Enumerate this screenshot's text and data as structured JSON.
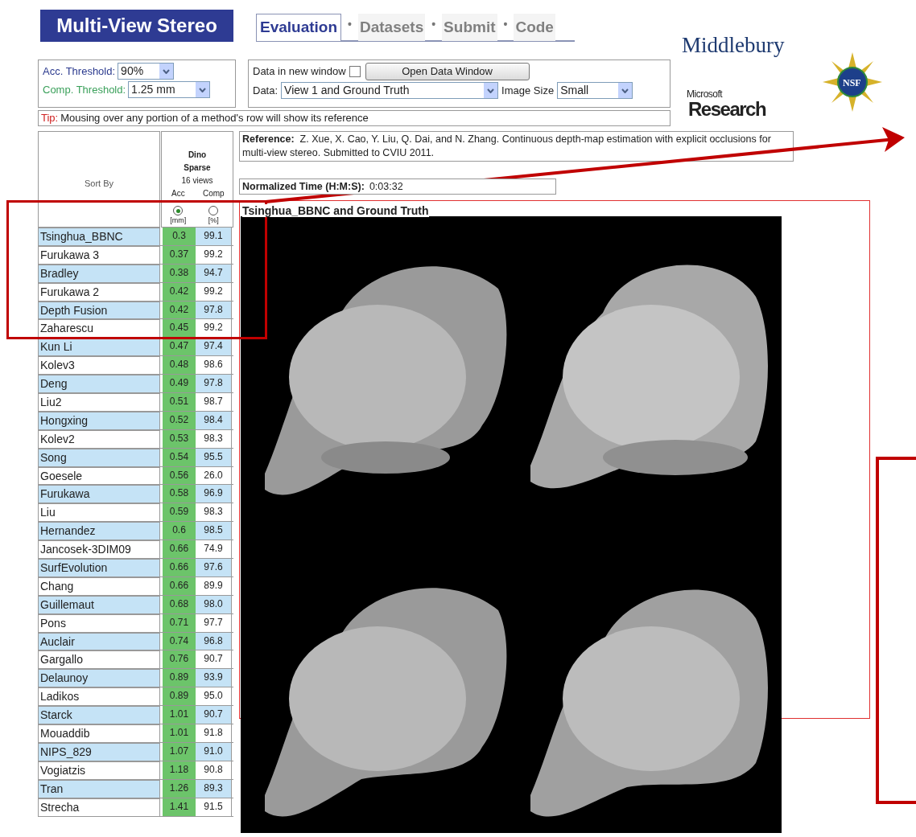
{
  "header": {
    "title": "Multi-View Stereo",
    "tabs": [
      {
        "kind": "tab",
        "label": "Evaluation",
        "selected": true
      },
      {
        "kind": "separator",
        "label": "•"
      },
      {
        "kind": "tab",
        "label": "Datasets",
        "selected": false
      },
      {
        "kind": "separator",
        "label": "•"
      },
      {
        "kind": "tab",
        "label": "Submit",
        "selected": false
      },
      {
        "kind": "separator",
        "label": "•"
      },
      {
        "kind": "tab",
        "label": "Code",
        "selected": false
      }
    ]
  },
  "logos": {
    "middlebury": "Middlebury",
    "microsoft": "Microsoft",
    "research": "Research",
    "nsf": "NSF"
  },
  "controls": {
    "acc_threshold": {
      "label": "Acc. Threshold:",
      "value": "90%"
    },
    "comp_threshold": {
      "label": "Comp. Threshold:",
      "value": "1.25 mm"
    },
    "new_window": {
      "label": "Data in new window",
      "checked": false
    },
    "open_button": "Open Data Window",
    "data": {
      "label": "Data:",
      "value": "View 1 and Ground Truth"
    },
    "image_size": {
      "label": "Image Size",
      "value": "Small"
    }
  },
  "tip": {
    "label": "Tip:",
    "text": "Mousing over any portion of a method's row will show its reference"
  },
  "table": {
    "dataset": "Dino",
    "subset": "Sparse",
    "views": "16 views",
    "sort_by": "Sort By",
    "columns": [
      {
        "label": "Acc",
        "unit": "[mm]",
        "selected": true
      },
      {
        "label": "Comp",
        "unit": "[%]",
        "selected": false
      }
    ],
    "rows": [
      {
        "method": "Tsinghua_BBNC",
        "acc": "0.3",
        "comp": "99.1"
      },
      {
        "method": "Furukawa 3",
        "acc": "0.37",
        "comp": "99.2"
      },
      {
        "method": "Bradley",
        "acc": "0.38",
        "comp": "94.7"
      },
      {
        "method": "Furukawa 2",
        "acc": "0.42",
        "comp": "99.2"
      },
      {
        "method": "Depth Fusion",
        "acc": "0.42",
        "comp": "97.8"
      },
      {
        "method": "Zaharescu",
        "acc": "0.45",
        "comp": "99.2"
      },
      {
        "method": "Kun Li",
        "acc": "0.47",
        "comp": "97.4"
      },
      {
        "method": "Kolev3",
        "acc": "0.48",
        "comp": "98.6"
      },
      {
        "method": "Deng",
        "acc": "0.49",
        "comp": "97.8"
      },
      {
        "method": "Liu2",
        "acc": "0.51",
        "comp": "98.7"
      },
      {
        "method": "Hongxing",
        "acc": "0.52",
        "comp": "98.4"
      },
      {
        "method": "Kolev2",
        "acc": "0.53",
        "comp": "98.3"
      },
      {
        "method": "Song",
        "acc": "0.54",
        "comp": "95.5"
      },
      {
        "method": "Goesele",
        "acc": "0.56",
        "comp": "26.0"
      },
      {
        "method": "Furukawa",
        "acc": "0.58",
        "comp": "96.9"
      },
      {
        "method": "Liu",
        "acc": "0.59",
        "comp": "98.3"
      },
      {
        "method": "Hernandez",
        "acc": "0.6",
        "comp": "98.5"
      },
      {
        "method": "Jancosek-3DIM09",
        "acc": "0.66",
        "comp": "74.9"
      },
      {
        "method": "SurfEvolution",
        "acc": "0.66",
        "comp": "97.6"
      },
      {
        "method": "Chang",
        "acc": "0.66",
        "comp": "89.9"
      },
      {
        "method": "Guillemaut",
        "acc": "0.68",
        "comp": "98.0"
      },
      {
        "method": "Pons",
        "acc": "0.71",
        "comp": "97.7"
      },
      {
        "method": "Auclair",
        "acc": "0.74",
        "comp": "96.8"
      },
      {
        "method": "Gargallo",
        "acc": "0.76",
        "comp": "90.7"
      },
      {
        "method": "Delaunoy",
        "acc": "0.89",
        "comp": "93.9"
      },
      {
        "method": "Ladikos",
        "acc": "0.89",
        "comp": "95.0"
      },
      {
        "method": "Starck",
        "acc": "1.01",
        "comp": "90.7"
      },
      {
        "method": "Mouaddib",
        "acc": "1.01",
        "comp": "91.8"
      },
      {
        "method": "NIPS_829",
        "acc": "1.07",
        "comp": "91.0"
      },
      {
        "method": "Vogiatzis",
        "acc": "1.18",
        "comp": "90.8"
      },
      {
        "method": "Tran",
        "acc": "1.26",
        "comp": "89.3"
      },
      {
        "method": "Strecha",
        "acc": "1.41",
        "comp": "91.5"
      }
    ]
  },
  "reference": {
    "label": "Reference:",
    "text": "Z. Xue, X. Cao, Y. Liu, Q. Dai, and N. Zhang. Continuous depth-map estimation with explicit occlusions for multi-view stereo. Submitted to CVIU 2011."
  },
  "time": {
    "label": "Normalized Time (H:M:S):",
    "value": "0:03:32"
  },
  "image_panel": {
    "title": "Tsinghua_BBNC and Ground Truth"
  }
}
